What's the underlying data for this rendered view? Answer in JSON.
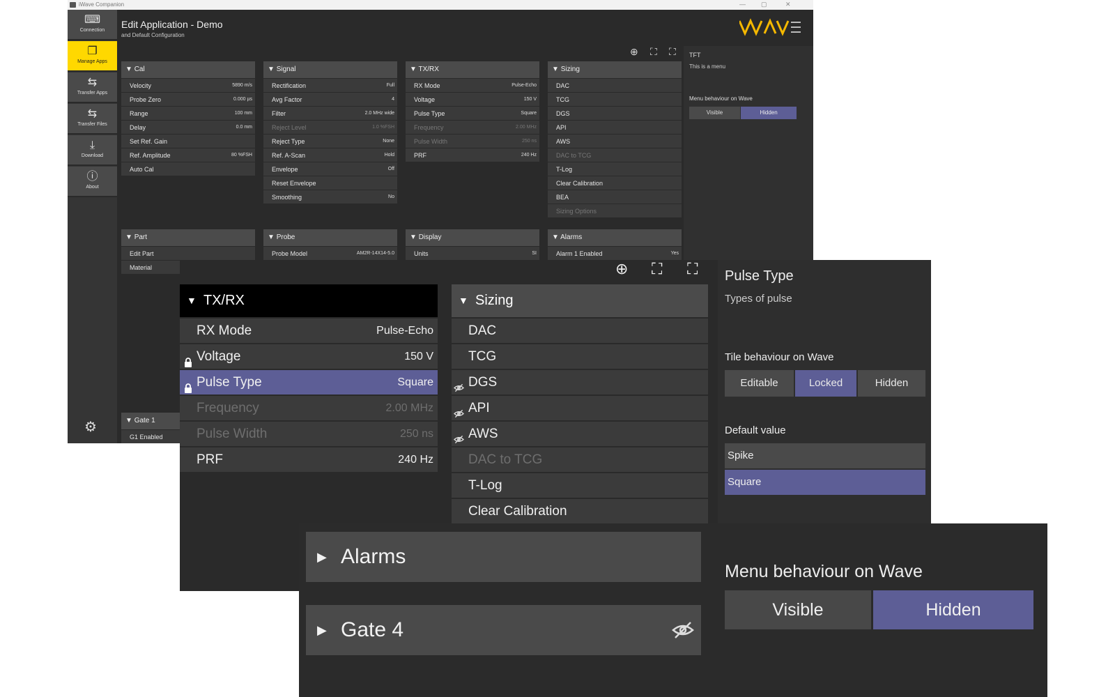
{
  "colors": {
    "accent_yellow": "#ffd800",
    "selected": "#5d5e96",
    "logo": "#f5b800"
  },
  "bg_window": {
    "titlebar": {
      "app_name": "iWave Companion",
      "min": "—",
      "max": "▢",
      "close": "✕"
    },
    "sidebar": [
      {
        "icon": "connection-icon",
        "glyph": "⌨",
        "label": "Connection",
        "active": false
      },
      {
        "icon": "manage-apps-icon",
        "glyph": "❐",
        "label": "Manage Apps",
        "active": true
      },
      {
        "icon": "transfer-apps-icon",
        "glyph": "⇆",
        "label": "Transfer Apps",
        "active": false
      },
      {
        "icon": "transfer-files-icon",
        "glyph": "⇆",
        "label": "Transfer Files",
        "active": false
      },
      {
        "icon": "download-icon",
        "glyph": "⤓",
        "label": "Download",
        "active": false
      },
      {
        "icon": "about-icon",
        "glyph": "ⓘ",
        "label": "About",
        "active": false
      }
    ],
    "settings_glyph": "⚙",
    "title": "Edit Application - Demo",
    "subtitle": "and Default Configuration",
    "tools": {
      "add": "⊕",
      "expand": "⛶",
      "collapse": "⛶"
    },
    "panels_top": [
      {
        "title": "Cal",
        "rows": [
          {
            "label": "Velocity",
            "value": "5890 m/s",
            "dim": false
          },
          {
            "label": "Probe Zero",
            "value": "0.000 µs",
            "dim": false
          },
          {
            "label": "Range",
            "value": "100 mm",
            "dim": false
          },
          {
            "label": "Delay",
            "value": "0.0 mm",
            "dim": false
          },
          {
            "label": "Set Ref. Gain",
            "value": "",
            "dim": false
          },
          {
            "label": "Ref. Amplitude",
            "value": "80 %FSH",
            "dim": false
          },
          {
            "label": "Auto Cal",
            "value": "",
            "dim": false
          }
        ]
      },
      {
        "title": "Signal",
        "rows": [
          {
            "label": "Rectification",
            "value": "Full",
            "dim": false
          },
          {
            "label": "Avg Factor",
            "value": "4",
            "dim": false
          },
          {
            "label": "Filter",
            "value": "2.0 MHz wide",
            "dim": false
          },
          {
            "label": "Reject Level",
            "value": "1.0 %FSH",
            "dim": true
          },
          {
            "label": "Reject Type",
            "value": "None",
            "dim": false
          },
          {
            "label": "Ref. A-Scan",
            "value": "Hold",
            "dim": false
          },
          {
            "label": "Envelope",
            "value": "Off",
            "dim": false
          },
          {
            "label": "Reset Envelope",
            "value": "",
            "dim": false
          },
          {
            "label": "Smoothing",
            "value": "No",
            "dim": false
          }
        ]
      },
      {
        "title": "TX/RX",
        "rows": [
          {
            "label": "RX Mode",
            "value": "Pulse-Echo",
            "dim": false
          },
          {
            "label": "Voltage",
            "value": "150 V",
            "dim": false
          },
          {
            "label": "Pulse Type",
            "value": "Square",
            "dim": false
          },
          {
            "label": "Frequency",
            "value": "2.00 MHz",
            "dim": true
          },
          {
            "label": "Pulse Width",
            "value": "250 ns",
            "dim": true
          },
          {
            "label": "PRF",
            "value": "240 Hz",
            "dim": false
          }
        ]
      },
      {
        "title": "Sizing",
        "rows": [
          {
            "label": "DAC",
            "value": "",
            "dim": false
          },
          {
            "label": "TCG",
            "value": "",
            "dim": false
          },
          {
            "label": "DGS",
            "value": "",
            "dim": false
          },
          {
            "label": "API",
            "value": "",
            "dim": false
          },
          {
            "label": "AWS",
            "value": "",
            "dim": false
          },
          {
            "label": "DAC to TCG",
            "value": "",
            "dim": true
          },
          {
            "label": "T-Log",
            "value": "",
            "dim": false
          },
          {
            "label": "Clear Calibration",
            "value": "",
            "dim": false
          },
          {
            "label": "BEA",
            "value": "",
            "dim": false
          },
          {
            "label": "Sizing Options",
            "value": "",
            "dim": true
          }
        ]
      }
    ],
    "panels_bottom": [
      {
        "title": "Part",
        "rows": [
          {
            "label": "Edit Part",
            "value": "",
            "dim": false
          },
          {
            "label": "Material",
            "value": "",
            "dim": false
          }
        ]
      },
      {
        "title": "Probe",
        "rows": [
          {
            "label": "Probe Model",
            "value": "AM2R-14X14-5.0",
            "dim": false
          }
        ]
      },
      {
        "title": "Display",
        "rows": [
          {
            "label": "Units",
            "value": "SI",
            "dim": false
          }
        ]
      },
      {
        "title": "Alarms",
        "rows": [
          {
            "label": "Alarm 1 Enabled",
            "value": "Yes",
            "dim": false
          }
        ]
      }
    ],
    "gate_panel": {
      "title": "Gate 1",
      "rows": [
        {
          "label": "G1 Enabled",
          "value": "",
          "dim": false
        }
      ]
    },
    "info": {
      "title": "TFT",
      "desc": "This is a menu",
      "behaviour_label": "Menu behaviour on Wave",
      "options": [
        "Visible",
        "Hidden"
      ]
    }
  },
  "mid_window": {
    "tools": {
      "add": "⊕",
      "expand": "⛶",
      "collapse": "⛶"
    },
    "txrx": {
      "title": "TX/RX",
      "rows": [
        {
          "label": "RX Mode",
          "value": "Pulse-Echo",
          "lock": false,
          "dim": false,
          "selected": false
        },
        {
          "label": "Voltage",
          "value": "150 V",
          "lock": true,
          "dim": false,
          "selected": false
        },
        {
          "label": "Pulse Type",
          "value": "Square",
          "lock": true,
          "dim": false,
          "selected": true
        },
        {
          "label": "Frequency",
          "value": "2.00 MHz",
          "lock": false,
          "dim": true,
          "selected": false
        },
        {
          "label": "Pulse Width",
          "value": "250 ns",
          "lock": false,
          "dim": true,
          "selected": false
        },
        {
          "label": "PRF",
          "value": "240 Hz",
          "lock": false,
          "dim": false,
          "selected": false
        }
      ]
    },
    "sizing": {
      "title": "Sizing",
      "rows": [
        {
          "label": "DAC",
          "hidden": false,
          "dim": false
        },
        {
          "label": "TCG",
          "hidden": false,
          "dim": false
        },
        {
          "label": "DGS",
          "hidden": true,
          "dim": false
        },
        {
          "label": "API",
          "hidden": true,
          "dim": false
        },
        {
          "label": "AWS",
          "hidden": true,
          "dim": false
        },
        {
          "label": "DAC to TCG",
          "hidden": false,
          "dim": true
        },
        {
          "label": "T-Log",
          "hidden": false,
          "dim": false
        },
        {
          "label": "Clear Calibration",
          "hidden": false,
          "dim": false
        }
      ]
    },
    "info": {
      "title": "Pulse Type",
      "desc": "Types of pulse",
      "tile_label": "Tile behaviour on Wave",
      "tile_options": [
        "Editable",
        "Locked",
        "Hidden"
      ],
      "tile_selected": 1,
      "default_label": "Default value",
      "default_options": [
        "Spike",
        "Square"
      ],
      "default_selected": 1
    }
  },
  "front_window": {
    "alarms": "Alarms",
    "gate4": "Gate 4",
    "menu_label": "Menu behaviour on Wave",
    "options": [
      "Visible",
      "Hidden"
    ],
    "selected": 1
  }
}
